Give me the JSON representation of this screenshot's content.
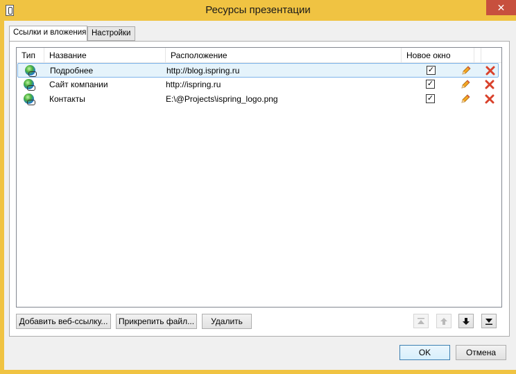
{
  "window": {
    "title": "Ресурсы презентации",
    "close_glyph": "✕",
    "accent_color": "#f0c342"
  },
  "tabs": [
    {
      "label": "Ссылки и вложения",
      "active": true
    },
    {
      "label": "Настройки",
      "active": false
    }
  ],
  "grid": {
    "columns": [
      "Тип",
      "Название",
      "Расположение",
      "Новое окно"
    ],
    "rows": [
      {
        "type_icon": "globe-link-icon",
        "name": "Подробнее",
        "location": "http://blog.ispring.ru",
        "new_window": true,
        "selected": true
      },
      {
        "type_icon": "globe-link-icon",
        "name": "Сайт компании",
        "location": "http://ispring.ru",
        "new_window": true,
        "selected": false
      },
      {
        "type_icon": "globe-link-icon",
        "name": "Контакты",
        "location": "E:\\@Projects\\ispring_logo.png",
        "new_window": true,
        "selected": false
      }
    ],
    "check_glyph": "✓"
  },
  "actions": {
    "add_link": "Добавить веб-ссылку...",
    "attach_file": "Прикрепить файл...",
    "delete": "Удалить"
  },
  "move_buttons": [
    {
      "name": "move-top-icon",
      "enabled": false
    },
    {
      "name": "move-up-icon",
      "enabled": false
    },
    {
      "name": "move-down-icon",
      "enabled": true
    },
    {
      "name": "move-bottom-icon",
      "enabled": true
    }
  ],
  "dialog": {
    "ok": "OK",
    "cancel": "Отмена"
  }
}
